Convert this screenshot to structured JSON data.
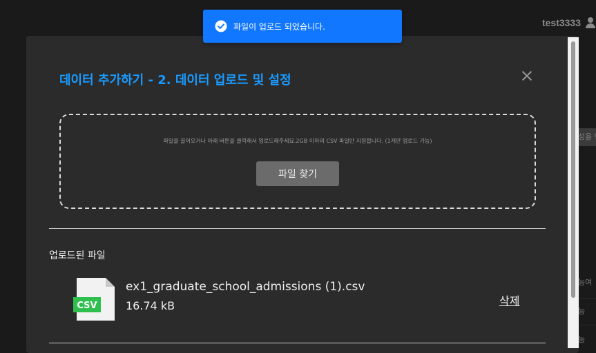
{
  "header": {
    "username": "test3333",
    "user_icon": "user-icon"
  },
  "background": {
    "button_fragment": "성을 만",
    "row_fragments": [
      "능여",
      "능",
      "능"
    ]
  },
  "toast": {
    "icon": "check-circle-icon",
    "message": "파일이 업로드 되었습니다."
  },
  "modal": {
    "title": "데이터 추가하기 - 2. 데이터 업로드 및 설정",
    "close_icon": "close-icon",
    "dropzone": {
      "hint": "파일을 끌어오거나 아래 버튼을 클릭해서 업로드해주세요.2GB 이하의 CSV 파일만 지원합니다. (1개만 업로드 가능)",
      "button_label": "파일 찾기"
    },
    "uploaded": {
      "section_label": "업로드된 파일",
      "file": {
        "icon": "csv-file-icon",
        "badge": "CSV",
        "name": "ex1_graduate_school_admissions (1).csv",
        "size": "16.74 kB",
        "delete_label": "삭제"
      }
    }
  },
  "colors": {
    "accent": "#1a9bff",
    "toast_bg": "#1177ff",
    "modal_bg": "#2b2b2b",
    "csv_badge": "#2fbf4f"
  }
}
